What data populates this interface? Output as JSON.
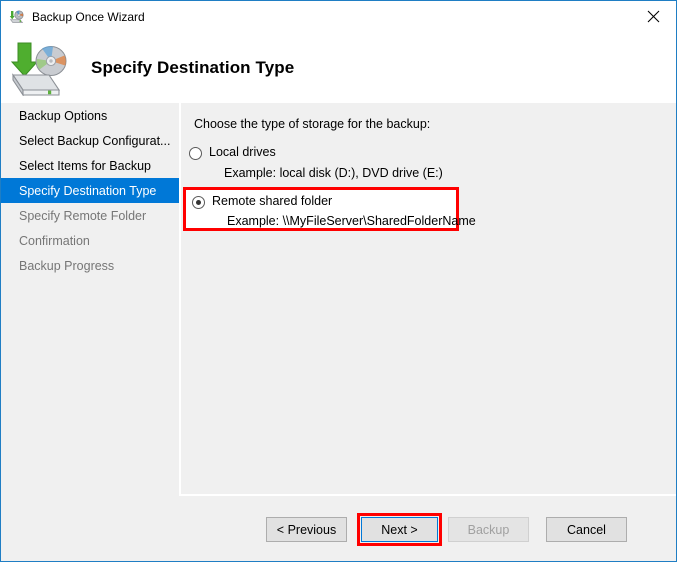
{
  "window": {
    "title": "Backup Once Wizard",
    "title_icon": "backup-wizard-icon",
    "close_icon": "close-icon",
    "accent_border": "#1f7ec4"
  },
  "header": {
    "icon": "backup-disk-icon",
    "title": "Specify Destination Type"
  },
  "sidebar": {
    "highlight_color": "#0078d7",
    "items": [
      {
        "label": "Backup Options",
        "state": "done"
      },
      {
        "label": "Select Backup Configurat...",
        "state": "done"
      },
      {
        "label": "Select Items for Backup",
        "state": "done"
      },
      {
        "label": "Specify Destination Type",
        "state": "active"
      },
      {
        "label": "Specify Remote Folder",
        "state": "pending"
      },
      {
        "label": "Confirmation",
        "state": "pending"
      },
      {
        "label": "Backup Progress",
        "state": "pending"
      }
    ]
  },
  "content": {
    "prompt": "Choose the type of storage for the backup:",
    "options": [
      {
        "label": "Local drives",
        "example": "Example: local disk (D:), DVD drive (E:)",
        "selected": false,
        "highlighted": false
      },
      {
        "label": "Remote shared folder",
        "example": "Example: \\\\MyFileServer\\SharedFolderName",
        "selected": true,
        "highlighted": true
      }
    ],
    "highlight_color": "#ff0000"
  },
  "buttons": [
    {
      "id": "previous",
      "label": "< Previous",
      "disabled": false,
      "focused": false,
      "highlighted": false
    },
    {
      "id": "next",
      "label": "Next >",
      "disabled": false,
      "focused": true,
      "highlighted": true
    },
    {
      "id": "backup",
      "label": "Backup",
      "disabled": true,
      "focused": false,
      "highlighted": false
    },
    {
      "id": "cancel",
      "label": "Cancel",
      "disabled": false,
      "focused": false,
      "highlighted": false
    }
  ]
}
